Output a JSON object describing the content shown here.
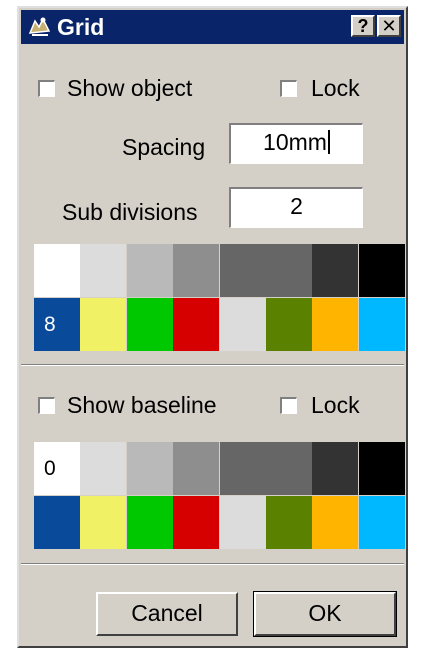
{
  "window": {
    "title": "Grid",
    "help_label": "?",
    "close_label": "✕"
  },
  "object_grid": {
    "show_label": "Show object",
    "lock_label": "Lock",
    "spacing_label": "Spacing",
    "spacing_value": "10mm",
    "subdiv_label": "Sub divisions",
    "subdiv_value": "2",
    "selected_index_label": "8",
    "top_row_colors": [
      "#ffffff",
      "#dcdcdc",
      "#b9b9b9",
      "#8e8e8e",
      "#666666",
      "#666666",
      "#333333",
      "#000000"
    ],
    "bottom_row_colors": [
      "#0a4a9a",
      "#f1f165",
      "#00c800",
      "#d70000",
      "#dcdcdc",
      "#5a8200",
      "#ffb400",
      "#00b8ff"
    ]
  },
  "baseline_grid": {
    "show_label": "Show baseline",
    "lock_label": "Lock",
    "selected_index_label": "0",
    "top_row_colors": [
      "#ffffff",
      "#dcdcdc",
      "#b9b9b9",
      "#8e8e8e",
      "#666666",
      "#666666",
      "#333333",
      "#000000"
    ],
    "bottom_row_colors": [
      "#0a4a9a",
      "#f1f165",
      "#00c800",
      "#d70000",
      "#dcdcdc",
      "#5a8200",
      "#ffb400",
      "#00b8ff"
    ]
  },
  "buttons": {
    "cancel": "Cancel",
    "ok": "OK"
  },
  "colors": {
    "titlebar": "#0a246a",
    "dialog_face": "#d4d0c8"
  },
  "icons": {
    "title": "grid-app-icon",
    "help": "help-icon",
    "close": "close-icon"
  }
}
